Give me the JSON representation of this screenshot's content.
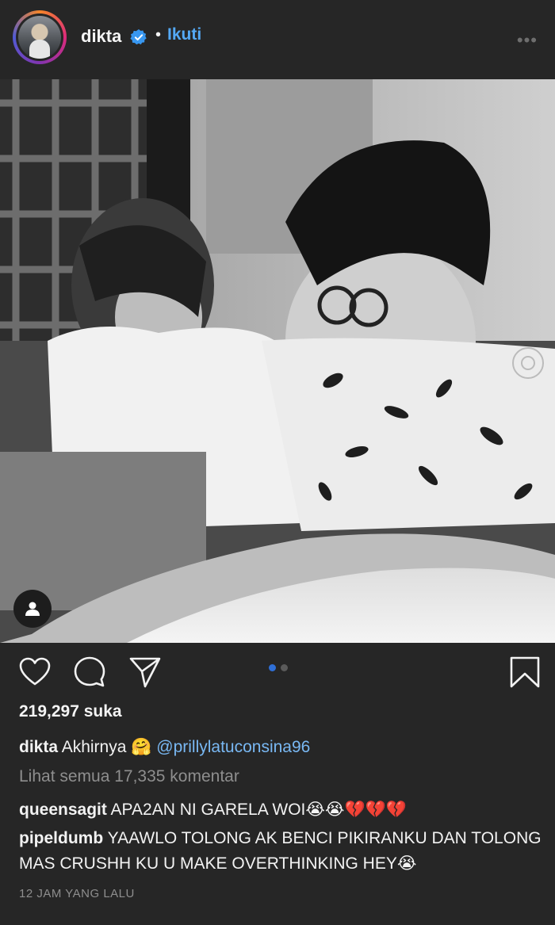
{
  "post": {
    "username": "dikta",
    "separator": "•",
    "follow_label": "Ikuti",
    "more_label": "•••"
  },
  "actions": {
    "carousel_count": 2,
    "carousel_active": 1
  },
  "likes": "219,297 suka",
  "caption": {
    "username": "dikta",
    "text": "Akhirnya",
    "emoji": "🤗",
    "mention": "@prillylatuconsina96"
  },
  "view_all_comments": "Lihat semua 17,335 komentar",
  "comments": [
    {
      "username": "queensagit",
      "text": "APA2AN NI GARELA WOI😭😭💔💔💔"
    },
    {
      "username": "pipeldumb",
      "text": "YAAWLO TOLONG AK BENCI PIKIRANKU DAN TOLONG MAS CRUSHH KU U MAKE OVERTHINKING HEY😭"
    }
  ],
  "timestamp": "12 JAM YANG LALU",
  "colors": {
    "background": "#262626",
    "link": "#54a9f5",
    "mention": "#79b8f3",
    "muted": "#8e8e8e",
    "carousel_active": "#2f6fd7"
  }
}
